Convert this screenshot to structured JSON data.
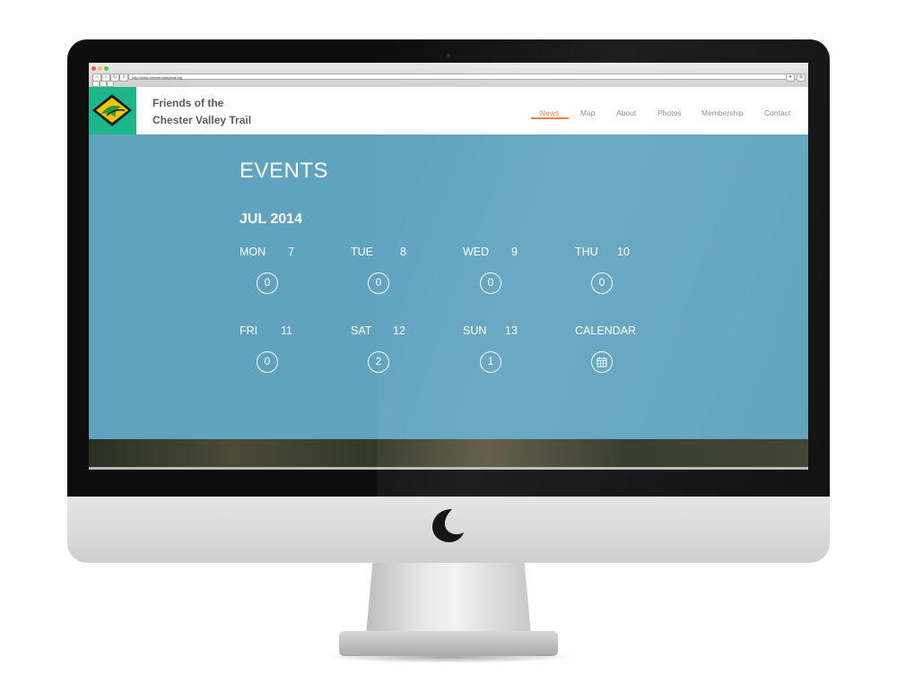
{
  "browser": {
    "url": "http://www.chestervalleytrail.org"
  },
  "site": {
    "brand_line1": "Friends of the",
    "brand_line2": "Chester Valley Trail",
    "logo_color": "#1db58a",
    "accent_color": "#f07a3c"
  },
  "nav": [
    {
      "label": "News",
      "active": true
    },
    {
      "label": "Map"
    },
    {
      "label": "About"
    },
    {
      "label": "Photos"
    },
    {
      "label": "Membership"
    },
    {
      "label": "Contact"
    }
  ],
  "events": {
    "title": "EVENTS",
    "month": "JUL  2014",
    "background": "#5fa3bf",
    "days": [
      {
        "day": "MON",
        "date": "7",
        "count": "0"
      },
      {
        "day": "TUE",
        "date": "8",
        "count": "0"
      },
      {
        "day": "WED",
        "date": "9",
        "count": "0"
      },
      {
        "day": "THU",
        "date": "10",
        "count": "0"
      },
      {
        "day": "FRI",
        "date": "11",
        "count": "0"
      },
      {
        "day": "SAT",
        "date": "12",
        "count": "2"
      },
      {
        "day": "SUN",
        "date": "13",
        "count": "1"
      }
    ],
    "calendar_label": "CALENDAR",
    "calendar_icon": "calendar-icon"
  }
}
